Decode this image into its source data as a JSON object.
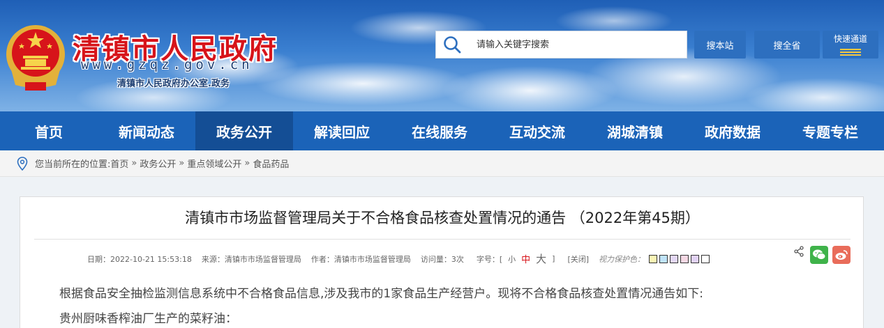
{
  "header": {
    "site_title": "清镇市人民政府",
    "domain": "www.gzqz.gov.cn",
    "subtitle": "清镇市人民政府办公室.政务",
    "search_placeholder": "请输入关键字搜索",
    "search_site_label": "搜本站",
    "search_province_label": "搜全省",
    "quick_nav_label": "快速通道"
  },
  "nav": {
    "items": [
      {
        "label": "首页"
      },
      {
        "label": "新闻动态"
      },
      {
        "label": "政务公开"
      },
      {
        "label": "解读回应"
      },
      {
        "label": "在线服务"
      },
      {
        "label": "互动交流"
      },
      {
        "label": "湖城清镇"
      },
      {
        "label": "政府数据"
      },
      {
        "label": "专题专栏"
      }
    ],
    "active": "政务公开"
  },
  "breadcrumb": {
    "prefix": "您当前所在的位置:",
    "items": [
      "首页",
      "政务公开",
      "重点领域公开",
      "食品药品"
    ],
    "separator": "»"
  },
  "article": {
    "title": "清镇市市场监督管理局关于不合格食品核查处置情况的通告 （2022年第45期）",
    "meta": {
      "date": "日期：2022-10-21 15:53:18",
      "source": "来源：清镇市市场监督管理局",
      "author": "作者：清镇市市场监督管理局",
      "views": "访问量：3次",
      "font_size_label": "字号：[",
      "font_small": "小",
      "font_mid": "中",
      "font_large": "大",
      "font_close": "]",
      "close_label": "[关闭]",
      "eye_protect_label": "视力保护色："
    },
    "swatch_colors": [
      "#fbf5b5",
      "#bfe3f8",
      "#e4d8f5",
      "#f5d8e4",
      "#e2d2f5",
      "#ffffff"
    ],
    "paragraphs": [
      "根据食品安全抽检监测信息系统中不合格食品信息,涉及我市的1家食品生产经营户。现将不合格食品核查处置情况通告如下:",
      "贵州厨味香榨油厂生产的菜籽油："
    ]
  }
}
